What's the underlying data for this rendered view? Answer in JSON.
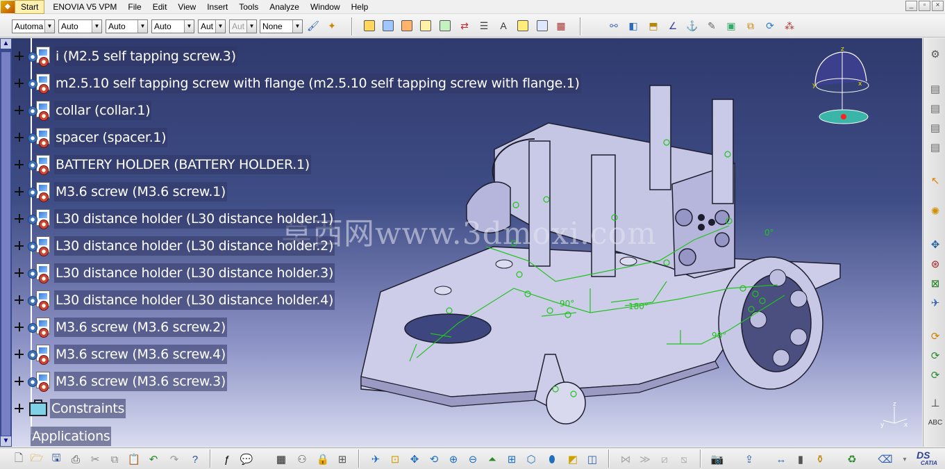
{
  "menu": {
    "items": [
      "Start",
      "ENOVIA V5 VPM",
      "File",
      "Edit",
      "View",
      "Insert",
      "Tools",
      "Analyze",
      "Window",
      "Help"
    ]
  },
  "window_controls": [
    "_",
    "▫",
    "×"
  ],
  "toolbar": {
    "combos": [
      {
        "value": "Automa",
        "disabled": false
      },
      {
        "value": "Auto",
        "disabled": false
      },
      {
        "value": "Auto",
        "disabled": false
      },
      {
        "value": "Auto",
        "disabled": false
      },
      {
        "value": "Aut",
        "disabled": false
      },
      {
        "value": "Aut",
        "disabled": true
      },
      {
        "value": "None",
        "disabled": false
      }
    ]
  },
  "spec_tree": {
    "nodes": [
      {
        "label": "i (M2.5  self tapping screw.3)"
      },
      {
        "label": "m2.5.10 self tapping screw with flange (m2.5.10 self tapping screw with flange.1)"
      },
      {
        "label": "collar (collar.1)"
      },
      {
        "label": "spacer (spacer.1)"
      },
      {
        "label": "BATTERY HOLDER (BATTERY HOLDER.1)"
      },
      {
        "label": "M3.6 screw (M3.6 screw.1)"
      },
      {
        "label": "L30 distance holder (L30 distance holder.1)"
      },
      {
        "label": "L30 distance holder (L30 distance holder.2)"
      },
      {
        "label": "L30 distance holder (L30 distance holder.3)"
      },
      {
        "label": "L30 distance holder (L30 distance holder.4)"
      },
      {
        "label": "M3.6 screw (M3.6 screw.2)"
      },
      {
        "label": "M3.6 screw (M3.6 screw.4)"
      },
      {
        "label": "M3.6 screw (M3.6 screw.3)"
      }
    ],
    "constraints_label": "Constraints",
    "applications_label": "Applications"
  },
  "viewport": {
    "watermark": "莫西网www.3dmoxi.com",
    "angle_labels": [
      "90°",
      "180°",
      "90°",
      "0°"
    ],
    "compass_axes": [
      "z",
      "y",
      "x"
    ],
    "corner_axes": [
      "z",
      "x",
      "y"
    ]
  },
  "logo": {
    "ds": "DS",
    "brand": "CATIA"
  },
  "colors": {
    "viewport_top": "#2f3a6e",
    "viewport_bottom": "#d9dcf0",
    "constraint_green": "#22c21e",
    "part_fill": "#c9c9e6"
  }
}
